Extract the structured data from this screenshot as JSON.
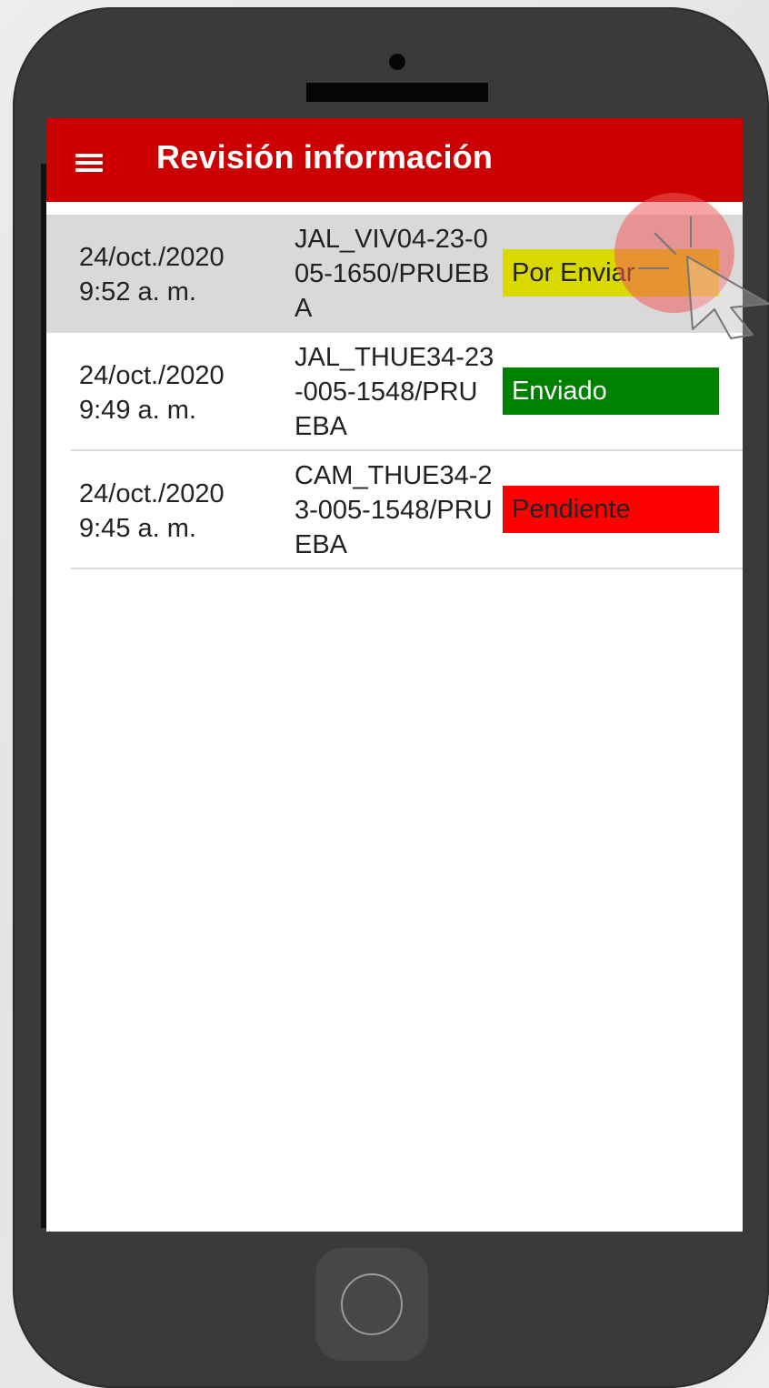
{
  "app": {
    "title": "Revisión información"
  },
  "menu": {
    "icon": "hamburger-menu-icon"
  },
  "records": [
    {
      "date": "24/oct./2020",
      "time": "9:52 a. m.",
      "code": "JAL_VIV04-23-005-1650/PRUEBA",
      "status": "Por Enviar",
      "status_bg": "#d9d900",
      "status_fg": "#222222",
      "selected": true
    },
    {
      "date": "24/oct./2020",
      "time": "9:49 a. m.",
      "code": "JAL_THUE34-23-005-1548/PRUEBA",
      "status": "Enviado",
      "status_bg": "#008000",
      "status_fg": "#ffffff",
      "selected": false
    },
    {
      "date": "24/oct./2020",
      "time": "9:45 a. m.",
      "code": "CAM_THUE34-23-005-1548/PRUEBA",
      "status": "Pendiente",
      "status_bg": "#ff0000",
      "status_fg": "#222222",
      "selected": false
    }
  ],
  "colors": {
    "appbar": "#cc0000",
    "selected_row": "#d9d9d9",
    "phone_body": "#3a3a3a"
  },
  "annotation": {
    "icon": "tap-cursor-icon"
  }
}
